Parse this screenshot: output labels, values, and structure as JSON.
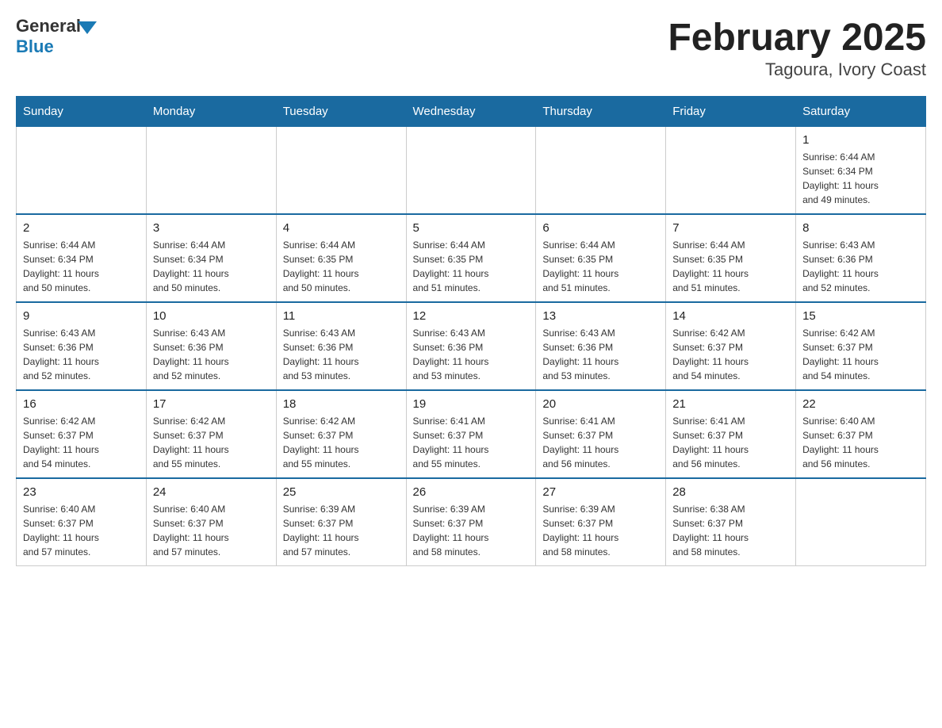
{
  "logo": {
    "general": "General",
    "blue": "Blue"
  },
  "title": "February 2025",
  "subtitle": "Tagoura, Ivory Coast",
  "days_header": [
    "Sunday",
    "Monday",
    "Tuesday",
    "Wednesday",
    "Thursday",
    "Friday",
    "Saturday"
  ],
  "weeks": [
    [
      {
        "day": "",
        "info": ""
      },
      {
        "day": "",
        "info": ""
      },
      {
        "day": "",
        "info": ""
      },
      {
        "day": "",
        "info": ""
      },
      {
        "day": "",
        "info": ""
      },
      {
        "day": "",
        "info": ""
      },
      {
        "day": "1",
        "info": "Sunrise: 6:44 AM\nSunset: 6:34 PM\nDaylight: 11 hours\nand 49 minutes."
      }
    ],
    [
      {
        "day": "2",
        "info": "Sunrise: 6:44 AM\nSunset: 6:34 PM\nDaylight: 11 hours\nand 50 minutes."
      },
      {
        "day": "3",
        "info": "Sunrise: 6:44 AM\nSunset: 6:34 PM\nDaylight: 11 hours\nand 50 minutes."
      },
      {
        "day": "4",
        "info": "Sunrise: 6:44 AM\nSunset: 6:35 PM\nDaylight: 11 hours\nand 50 minutes."
      },
      {
        "day": "5",
        "info": "Sunrise: 6:44 AM\nSunset: 6:35 PM\nDaylight: 11 hours\nand 51 minutes."
      },
      {
        "day": "6",
        "info": "Sunrise: 6:44 AM\nSunset: 6:35 PM\nDaylight: 11 hours\nand 51 minutes."
      },
      {
        "day": "7",
        "info": "Sunrise: 6:44 AM\nSunset: 6:35 PM\nDaylight: 11 hours\nand 51 minutes."
      },
      {
        "day": "8",
        "info": "Sunrise: 6:43 AM\nSunset: 6:36 PM\nDaylight: 11 hours\nand 52 minutes."
      }
    ],
    [
      {
        "day": "9",
        "info": "Sunrise: 6:43 AM\nSunset: 6:36 PM\nDaylight: 11 hours\nand 52 minutes."
      },
      {
        "day": "10",
        "info": "Sunrise: 6:43 AM\nSunset: 6:36 PM\nDaylight: 11 hours\nand 52 minutes."
      },
      {
        "day": "11",
        "info": "Sunrise: 6:43 AM\nSunset: 6:36 PM\nDaylight: 11 hours\nand 53 minutes."
      },
      {
        "day": "12",
        "info": "Sunrise: 6:43 AM\nSunset: 6:36 PM\nDaylight: 11 hours\nand 53 minutes."
      },
      {
        "day": "13",
        "info": "Sunrise: 6:43 AM\nSunset: 6:36 PM\nDaylight: 11 hours\nand 53 minutes."
      },
      {
        "day": "14",
        "info": "Sunrise: 6:42 AM\nSunset: 6:37 PM\nDaylight: 11 hours\nand 54 minutes."
      },
      {
        "day": "15",
        "info": "Sunrise: 6:42 AM\nSunset: 6:37 PM\nDaylight: 11 hours\nand 54 minutes."
      }
    ],
    [
      {
        "day": "16",
        "info": "Sunrise: 6:42 AM\nSunset: 6:37 PM\nDaylight: 11 hours\nand 54 minutes."
      },
      {
        "day": "17",
        "info": "Sunrise: 6:42 AM\nSunset: 6:37 PM\nDaylight: 11 hours\nand 55 minutes."
      },
      {
        "day": "18",
        "info": "Sunrise: 6:42 AM\nSunset: 6:37 PM\nDaylight: 11 hours\nand 55 minutes."
      },
      {
        "day": "19",
        "info": "Sunrise: 6:41 AM\nSunset: 6:37 PM\nDaylight: 11 hours\nand 55 minutes."
      },
      {
        "day": "20",
        "info": "Sunrise: 6:41 AM\nSunset: 6:37 PM\nDaylight: 11 hours\nand 56 minutes."
      },
      {
        "day": "21",
        "info": "Sunrise: 6:41 AM\nSunset: 6:37 PM\nDaylight: 11 hours\nand 56 minutes."
      },
      {
        "day": "22",
        "info": "Sunrise: 6:40 AM\nSunset: 6:37 PM\nDaylight: 11 hours\nand 56 minutes."
      }
    ],
    [
      {
        "day": "23",
        "info": "Sunrise: 6:40 AM\nSunset: 6:37 PM\nDaylight: 11 hours\nand 57 minutes."
      },
      {
        "day": "24",
        "info": "Sunrise: 6:40 AM\nSunset: 6:37 PM\nDaylight: 11 hours\nand 57 minutes."
      },
      {
        "day": "25",
        "info": "Sunrise: 6:39 AM\nSunset: 6:37 PM\nDaylight: 11 hours\nand 57 minutes."
      },
      {
        "day": "26",
        "info": "Sunrise: 6:39 AM\nSunset: 6:37 PM\nDaylight: 11 hours\nand 58 minutes."
      },
      {
        "day": "27",
        "info": "Sunrise: 6:39 AM\nSunset: 6:37 PM\nDaylight: 11 hours\nand 58 minutes."
      },
      {
        "day": "28",
        "info": "Sunrise: 6:38 AM\nSunset: 6:37 PM\nDaylight: 11 hours\nand 58 minutes."
      },
      {
        "day": "",
        "info": ""
      }
    ]
  ]
}
